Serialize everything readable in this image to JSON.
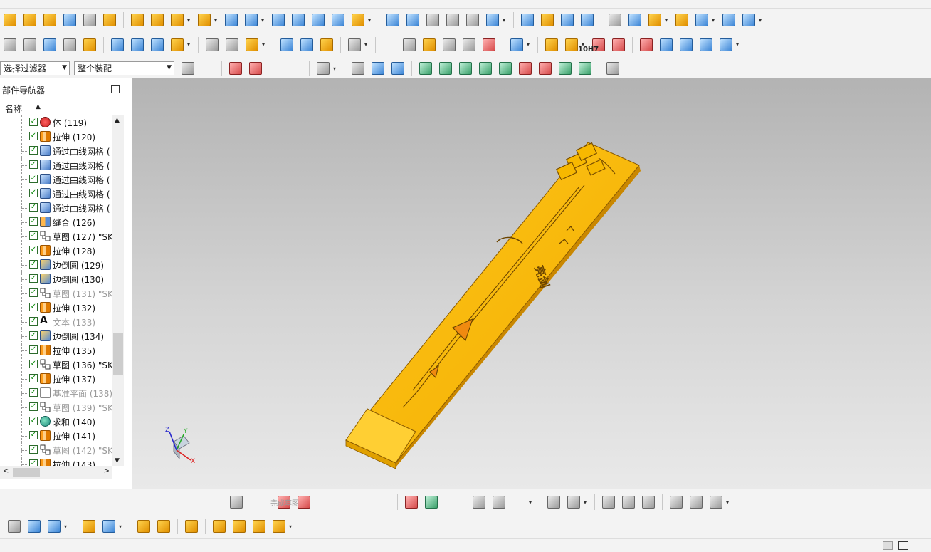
{
  "toolbar": {
    "filter_value": "选择过滤器",
    "assembly_scope": "整个装配",
    "tolerance_label": "10H7"
  },
  "navigator": {
    "title": "部件导航器",
    "column_name": "名称",
    "rows": [
      {
        "label": "体 (119)",
        "icon": "body-icon",
        "dim": false
      },
      {
        "label": "拉伸 (120)",
        "icon": "extrude-icon",
        "dim": false
      },
      {
        "label": "通过曲线网格 (",
        "icon": "mesh-surface-icon",
        "dim": false
      },
      {
        "label": "通过曲线网格 (",
        "icon": "mesh-surface-icon",
        "dim": false
      },
      {
        "label": "通过曲线网格 (",
        "icon": "mesh-surface-icon",
        "dim": false
      },
      {
        "label": "通过曲线网格 (",
        "icon": "mesh-surface-icon",
        "dim": false
      },
      {
        "label": "通过曲线网格 (",
        "icon": "mesh-surface-icon",
        "dim": false
      },
      {
        "label": "缝合 (126)",
        "icon": "sew-icon",
        "dim": false
      },
      {
        "label": "草图 (127) \"SK",
        "icon": "sketch-icon",
        "dim": false
      },
      {
        "label": "拉伸 (128)",
        "icon": "extrude-icon",
        "dim": false
      },
      {
        "label": "边倒圆 (129)",
        "icon": "edge-blend-icon",
        "dim": false
      },
      {
        "label": "边倒圆 (130)",
        "icon": "edge-blend-icon",
        "dim": false
      },
      {
        "label": "草图 (131) \"SK",
        "icon": "sketch-icon",
        "dim": true
      },
      {
        "label": "拉伸 (132)",
        "icon": "extrude-icon",
        "dim": false
      },
      {
        "label": "文本 (133)",
        "icon": "text-icon",
        "dim": true
      },
      {
        "label": "边倒圆 (134)",
        "icon": "edge-blend-icon",
        "dim": false
      },
      {
        "label": "拉伸 (135)",
        "icon": "extrude-icon",
        "dim": false
      },
      {
        "label": "草图 (136) \"SK",
        "icon": "sketch-icon",
        "dim": false
      },
      {
        "label": "拉伸 (137)",
        "icon": "extrude-icon",
        "dim": false
      },
      {
        "label": "基准平面 (138)",
        "icon": "datum-plane-icon",
        "dim": true
      },
      {
        "label": "草图 (139) \"SK",
        "icon": "sketch-icon",
        "dim": true
      },
      {
        "label": "求和 (140)",
        "icon": "unite-icon",
        "dim": false
      },
      {
        "label": "拉伸 (141)",
        "icon": "extrude-icon",
        "dim": false
      },
      {
        "label": "草图 (142) \"SK",
        "icon": "sketch-icon",
        "dim": true
      },
      {
        "label": "拉伸 (143)",
        "icon": "extrude-icon",
        "dim": false
      }
    ]
  },
  "model": {
    "engraved_text": "亮剑"
  },
  "sketch_toolbar": {
    "finish_sketch_label": "完成草图"
  },
  "triad": {
    "x_label": "X",
    "y_label": "Y",
    "z_label": "Z"
  },
  "colors": {
    "model_face": "#f5b800",
    "model_side": "#d99a00",
    "viewport_top": "#b3b3b3",
    "viewport_bottom": "#e9e9e9"
  }
}
